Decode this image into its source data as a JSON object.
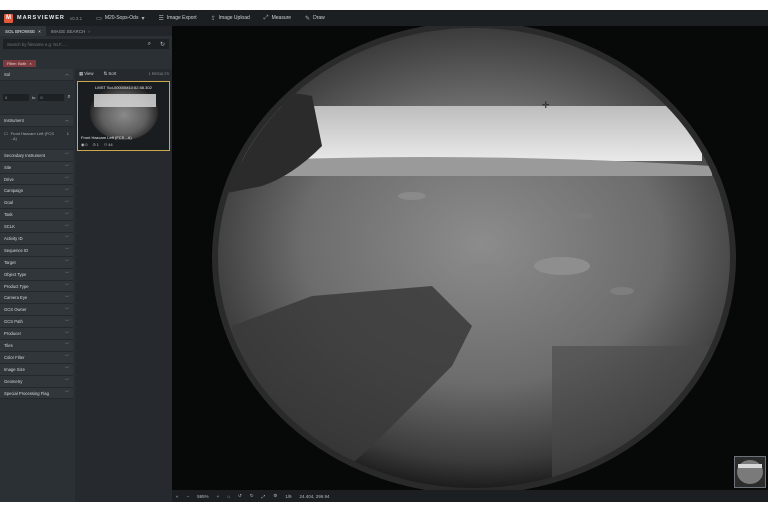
{
  "app": {
    "brand": "MARSVIEWER",
    "version": "v0.3.1",
    "dataset": "M20-Sops-Ods",
    "toolbar": [
      "Image Export",
      "Image Upload",
      "Measure",
      "Draw"
    ]
  },
  "sidebar": {
    "tabs": [
      {
        "label": "SOL BROWSE",
        "close": "×"
      },
      {
        "label": "IMAGE SEARCH",
        "close": "›"
      }
    ],
    "search_placeholder": "Search by filename e.g. NLF.....",
    "chip": "Filter: Both",
    "sol_label": "Sol",
    "sol_from": "0",
    "sol_to": "0",
    "sol_to_word": "to",
    "instrument_label": "Instrument",
    "instrument_item": "Front Hazcam Left (FCS - A)",
    "instrument_count": "1",
    "filters": [
      "Secondary Instrument",
      "Site",
      "Drive",
      "Campaign",
      "Goal",
      "Task",
      "SCLK",
      "Activity ID",
      "Sequence ID",
      "Target",
      "Object Type",
      "Product Type",
      "Camera Eye",
      "GCS Owner",
      "GCS Path",
      "Producer",
      "Tiles",
      "Color Filter",
      "Image Size",
      "Geometry",
      "Special Processing Flag"
    ]
  },
  "results": {
    "view": "View",
    "sort": "Sort",
    "count": "1 RESULTS",
    "card": {
      "title": "LMST Sol-00000M10:52:58.302",
      "caption": "Front Hazcam Left (FCS - A)",
      "meta": [
        "0",
        "1",
        "44"
      ]
    }
  },
  "viewer": {
    "zoom": "595%",
    "page": "1/9",
    "coords": "24.404, 296.94"
  }
}
